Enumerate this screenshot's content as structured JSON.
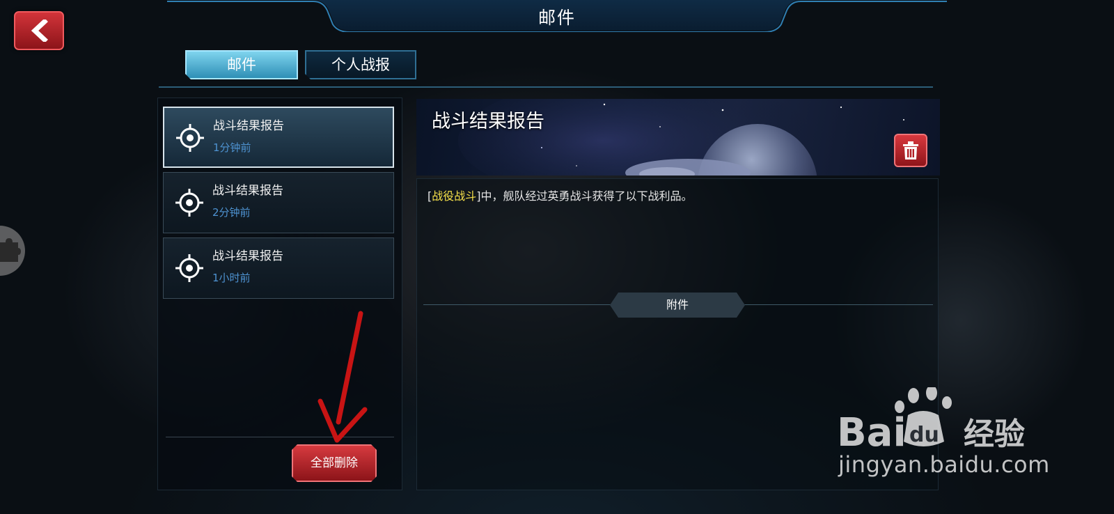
{
  "header": {
    "title": "邮件",
    "back_icon": "chevron-left-icon"
  },
  "tabs": [
    {
      "label": "邮件",
      "active": true
    },
    {
      "label": "个人战报",
      "active": false
    }
  ],
  "mail_list": {
    "items": [
      {
        "icon": "target-icon",
        "title": "战斗结果报告",
        "time": "1分钟前",
        "selected": true
      },
      {
        "icon": "target-icon",
        "title": "战斗结果报告",
        "time": "2分钟前",
        "selected": false
      },
      {
        "icon": "target-icon",
        "title": "战斗结果报告",
        "time": "1小时前",
        "selected": false
      }
    ],
    "delete_all_label": "全部删除"
  },
  "detail": {
    "title": "战斗结果报告",
    "delete_icon": "trash-icon",
    "message": {
      "open_bracket": "[",
      "battle_name": "战役战斗",
      "close_bracket": "]",
      "text": "中，舰队经过英勇战斗获得了以下战利品。"
    },
    "attachment_label": "附件"
  },
  "colors": {
    "accent_blue": "#4e93d2",
    "highlight_yellow": "#f5e04a",
    "danger_red": "#c2272d",
    "tab_active": "#5bbfe0"
  },
  "watermark": {
    "brand_text": "Bai",
    "brand_text_2": "du",
    "brand_cn": "经验",
    "url": "jingyan.baidu.com"
  }
}
